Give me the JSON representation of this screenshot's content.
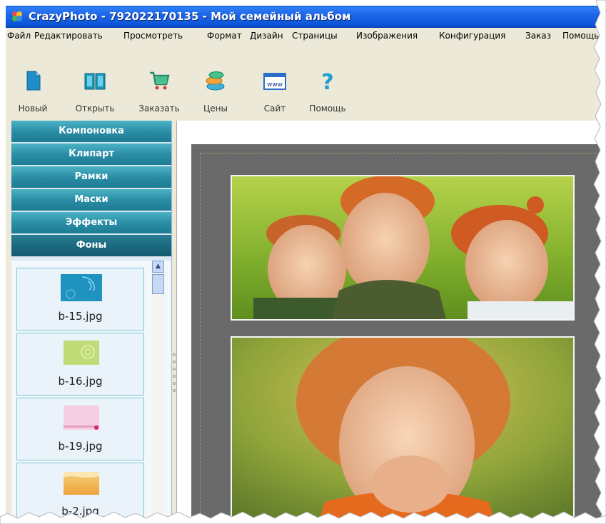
{
  "window": {
    "title": "CrazyPhoto - 792022170135 - Мой семейный альбом"
  },
  "menu": [
    {
      "label": "Файл"
    },
    {
      "label": "Редактировать"
    },
    {
      "label": "Просмотреть"
    },
    {
      "label": "Формат"
    },
    {
      "label": "Дизайн"
    },
    {
      "label": "Страницы"
    },
    {
      "label": "Изображения"
    },
    {
      "label": "Конфигурация"
    },
    {
      "label": "Заказ"
    },
    {
      "label": "Помощь"
    }
  ],
  "toolbar": [
    {
      "label": "Новый",
      "icon": "new-document-icon"
    },
    {
      "label": "Открыть",
      "icon": "open-book-icon"
    },
    {
      "label": "Заказать",
      "icon": "shopping-cart-icon"
    },
    {
      "label": "Цены",
      "icon": "coins-icon"
    },
    {
      "label": "Сайт",
      "icon": "www-icon"
    },
    {
      "label": "Помощь",
      "icon": "question-mark-icon"
    }
  ],
  "toolbar_icon_text": {
    "www": "www",
    "help": "?"
  },
  "sidebar": {
    "panels": [
      {
        "label": "Компоновка"
      },
      {
        "label": "Клипарт"
      },
      {
        "label": "Рамки"
      },
      {
        "label": "Маски"
      },
      {
        "label": "Эффекты"
      },
      {
        "label": "Фоны",
        "active": true
      }
    ],
    "backgrounds": [
      {
        "name": "b-15.jpg",
        "color": "#2a9bc4"
      },
      {
        "name": "b-16.jpg",
        "color": "#b8d86a"
      },
      {
        "name": "b-19.jpg",
        "color": "#f2c6dc"
      },
      {
        "name": "b-2.jpg",
        "color": "#f2b43e"
      }
    ]
  },
  "colors": {
    "titlebar": "#0a54d6",
    "panel_button": "#2a8ea6",
    "panel_active": "#1b6a80",
    "page_background": "#6a6a6a"
  }
}
